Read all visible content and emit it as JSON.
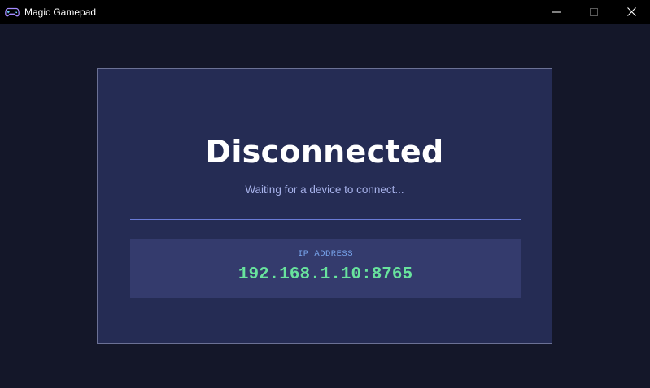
{
  "window": {
    "title": "Magic Gamepad",
    "app_icon": "gamepad-icon",
    "controls": [
      "minimize-icon",
      "maximize-icon",
      "close-icon"
    ]
  },
  "status": {
    "title": "Disconnected",
    "subtitle": "Waiting for a device to connect..."
  },
  "connection": {
    "ip_label": "IP ADDRESS",
    "ip_value": "192.168.1.10:8765"
  },
  "colors": {
    "background": "#141729",
    "card": "#252c54",
    "ip_box": "#343b6d",
    "accent_label": "#79a6ee",
    "ip_value": "#68e39d",
    "divider": "#6a7bd6"
  }
}
